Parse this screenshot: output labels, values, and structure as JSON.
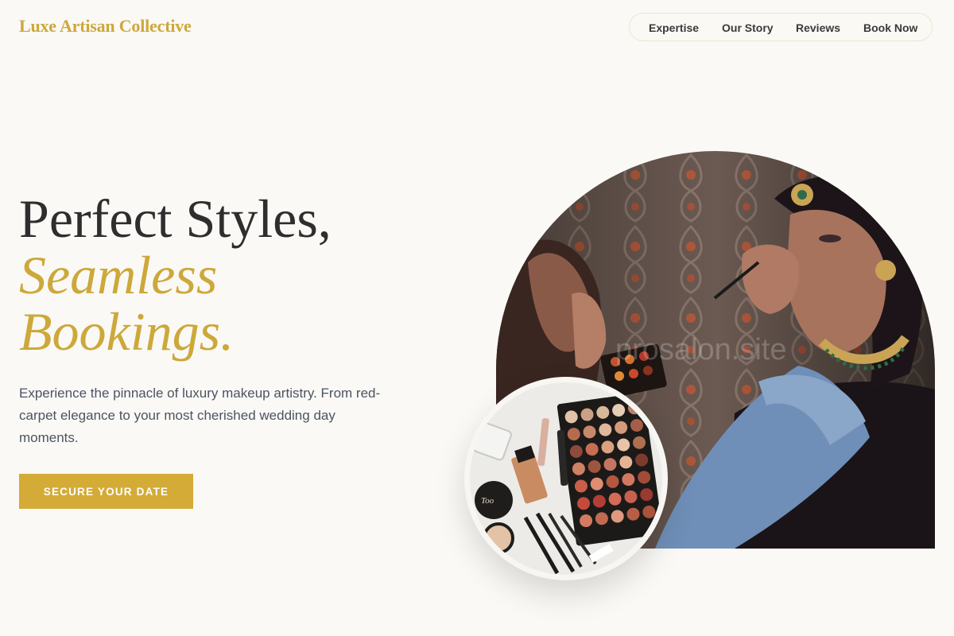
{
  "brand": {
    "name": "Luxe Artisan Collective",
    "color": "#cda83a"
  },
  "nav": {
    "items": [
      {
        "label": "Expertise"
      },
      {
        "label": "Our Story"
      },
      {
        "label": "Reviews"
      },
      {
        "label": "Book Now"
      }
    ]
  },
  "hero": {
    "title_line1": "Perfect Styles,",
    "title_line2": "Seamless",
    "title_line3": "Bookings.",
    "description": "Experience the pinnacle of luxury makeup artistry. From red-carpet elegance to your most cherished wedding day moments.",
    "cta_label": "SECURE YOUR DATE",
    "accent_color": "#d4ab36"
  },
  "images": {
    "main_photo_watermark": "prosalon.site"
  }
}
